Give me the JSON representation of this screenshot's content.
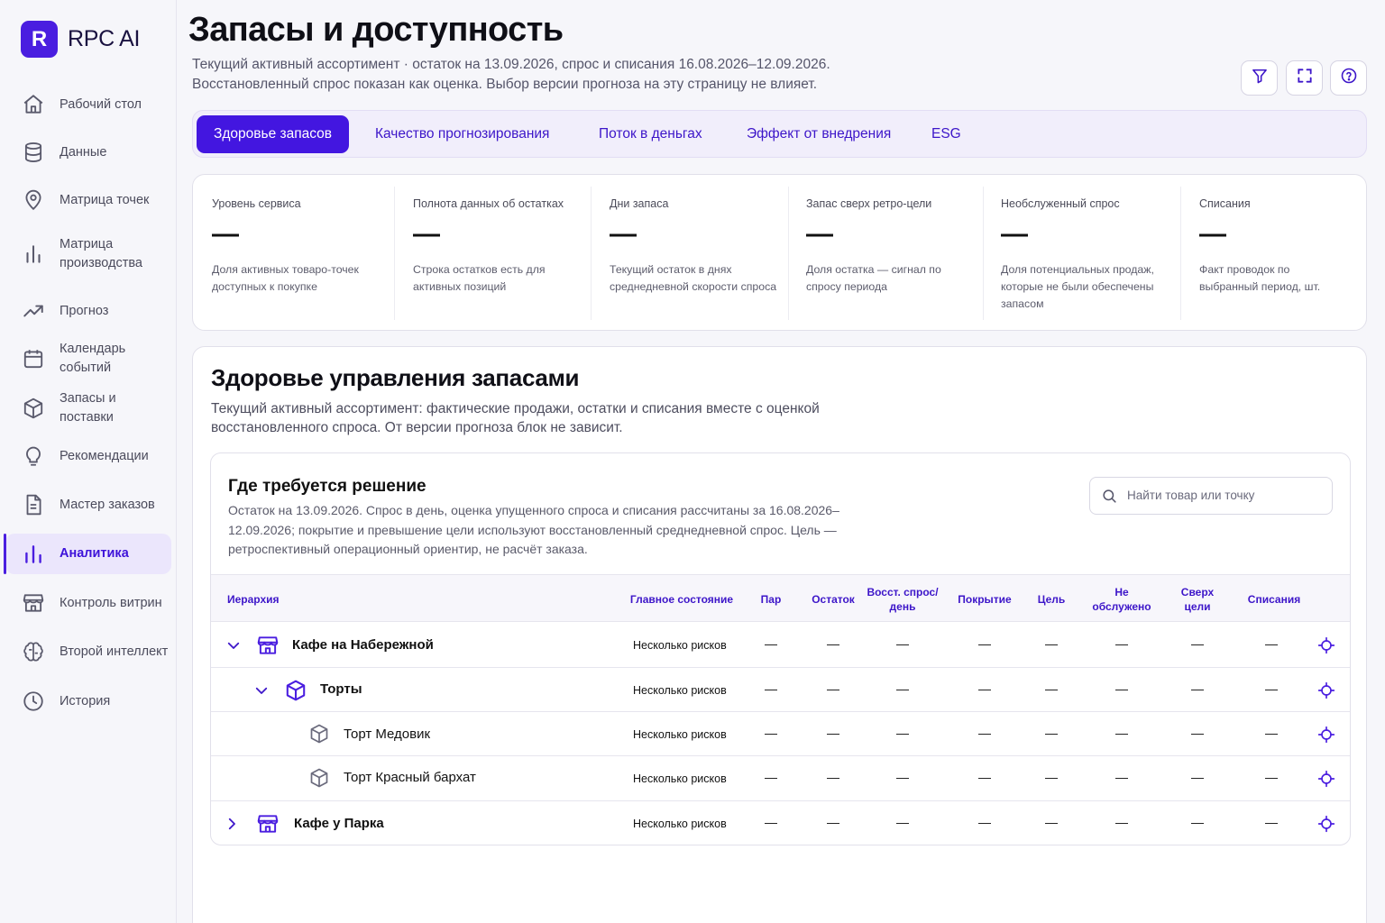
{
  "brand": {
    "logo_letter": "R",
    "name": "RPC AI",
    "accent": "#4a1ee0"
  },
  "sidebar": {
    "items": [
      {
        "label": "Рабочий стол",
        "icon": "home-icon"
      },
      {
        "label": "Данные",
        "icon": "database-icon"
      },
      {
        "label": "Матрица точек",
        "icon": "map-pin-icon"
      },
      {
        "label": "Матрица производства",
        "icon": "bar-chart-icon"
      },
      {
        "label": "Прогноз",
        "icon": "trend-icon"
      },
      {
        "label": "Календарь событий",
        "icon": "calendar-icon"
      },
      {
        "label": "Запасы и поставки",
        "icon": "box-icon"
      },
      {
        "label": "Рекомендации",
        "icon": "lightbulb-icon"
      },
      {
        "label": "Мастер заказов",
        "icon": "document-icon"
      },
      {
        "label": "Аналитика",
        "icon": "analytics-icon",
        "active": true
      },
      {
        "label": "Контроль витрин",
        "icon": "store-icon"
      },
      {
        "label": "Второй интеллект",
        "icon": "brain-icon"
      },
      {
        "label": "История",
        "icon": "clock-icon"
      }
    ]
  },
  "header": {
    "title": "Запасы и доступность",
    "subtitle_line1": "Текущий активный ассортимент · остаток на 13.09.2026, спрос и списания 16.08.2026–12.09.2026.",
    "subtitle_line2": "Восстановленный спрос показан как оценка. Выбор версии прогноза на эту страницу не влияет.",
    "buttons": [
      "filter-icon",
      "fullscreen-icon",
      "help-icon"
    ]
  },
  "tabs": [
    {
      "label": "Здоровье запасов",
      "active": true
    },
    {
      "label": "Качество прогнозирования"
    },
    {
      "label": "Поток в деньгах"
    },
    {
      "label": "Эффект от внедрения"
    },
    {
      "label": "ESG"
    }
  ],
  "kpis": [
    {
      "label": "Уровень сервиса",
      "value": "—",
      "desc": "Доля активных товаро-точек доступных к покупке"
    },
    {
      "label": "Полнота данных об остатках",
      "value": "—",
      "desc": "Строка остатков есть для активных позиций"
    },
    {
      "label": "Дни запаса",
      "value": "—",
      "desc": "Текущий остаток в днях среднедневной скорости спроса"
    },
    {
      "label": "Запас сверх ретро-цели",
      "value": "—",
      "desc": "Доля остатка — сигнал по спросу периода"
    },
    {
      "label": "Необслуженный спрос",
      "value": "—",
      "desc": "Доля потенциальных продаж, которые не были обеспечены запасом"
    },
    {
      "label": "Списания",
      "value": "—",
      "desc": "Факт проводок по выбранный период, шт."
    }
  ],
  "card": {
    "title": "Здоровье управления запасами",
    "desc": "Текущий активный ассортимент: фактические продажи, остатки и списания вместе с оценкой восстановленного спроса. От версии прогноза блок не зависит."
  },
  "decision": {
    "title": "Где требуется решение",
    "desc": "Остаток на 13.09.2026. Спрос в день, оценка упущенного спроса и списания рассчитаны за 16.08.2026–12.09.2026; покрытие и превышение цели используют восстановленный среднедневной спрос. Цель — ретроспективный операционный ориентир, не расчёт заказа.",
    "search_placeholder": "Найти товар или точку",
    "columns": [
      "Иерархия",
      "Главное состояние",
      "Пар",
      "Остаток",
      "Восст. спрос/день",
      "Покрытие",
      "Цель",
      "Не обслужено",
      "Сверх цели",
      "Списания"
    ],
    "rows": [
      {
        "name": "Кафе на Набережной",
        "level": 0,
        "type": "store",
        "expanded": true,
        "status": "Несколько рисков",
        "values": [
          "—",
          "—",
          "—",
          "—",
          "—",
          "—",
          "—",
          "—"
        ]
      },
      {
        "name": "Торты",
        "level": 1,
        "type": "category",
        "expanded": true,
        "status": "Несколько рисков",
        "values": [
          "—",
          "—",
          "—",
          "—",
          "—",
          "—",
          "—",
          "—"
        ]
      },
      {
        "name": "Торт Медовик",
        "level": 2,
        "type": "product",
        "status": "Несколько рисков",
        "values": [
          "—",
          "—",
          "—",
          "—",
          "—",
          "—",
          "—",
          "—"
        ]
      },
      {
        "name": "Торт Красный бархат",
        "level": 2,
        "type": "product",
        "status": "Несколько рисков",
        "values": [
          "—",
          "—",
          "—",
          "—",
          "—",
          "—",
          "—",
          "—"
        ]
      },
      {
        "name": "Кафе у Парка",
        "level": 0,
        "type": "store",
        "expanded": false,
        "status": "Несколько рисков",
        "values": [
          "—",
          "—",
          "—",
          "—",
          "—",
          "—",
          "—",
          "—"
        ]
      }
    ]
  }
}
